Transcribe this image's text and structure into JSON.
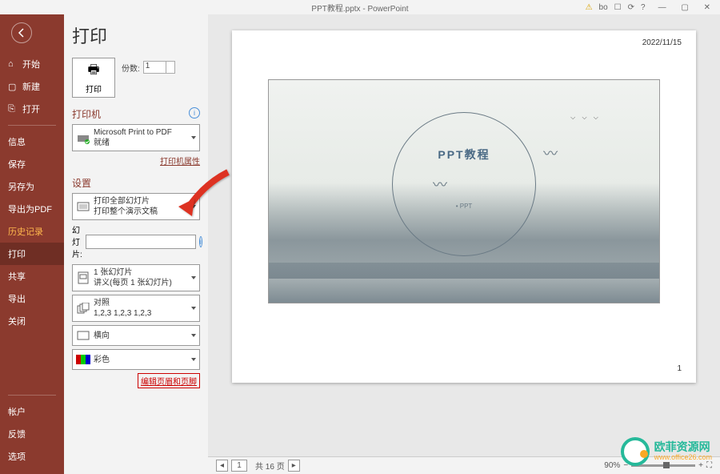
{
  "titlebar": {
    "filename": "PPT教程.pptx",
    "appname": "PowerPoint",
    "user": "bo"
  },
  "sidebar": {
    "start": "开始",
    "new": "新建",
    "open": "打开",
    "info": "信息",
    "save": "保存",
    "saveas": "另存为",
    "exportpdf": "导出为PDF",
    "history": "历史记录",
    "print": "打印",
    "share": "共享",
    "export": "导出",
    "close": "关闭",
    "account": "帐户",
    "feedback": "反馈",
    "options": "选项"
  },
  "page": {
    "title": "打印"
  },
  "print_button": {
    "label": "打印"
  },
  "copies": {
    "label": "份数:",
    "value": "1"
  },
  "printer": {
    "header": "打印机",
    "name": "Microsoft Print to PDF",
    "status": "就绪",
    "props_link": "打印机属性"
  },
  "settings": {
    "header": "设置",
    "scope": {
      "line1": "打印全部幻灯片",
      "line2": "打印整个演示文稿"
    },
    "slides_label": "幻灯片:",
    "layout": {
      "line1": "1 张幻灯片",
      "line2": "讲义(每页 1 张幻灯片)"
    },
    "collate": {
      "line1": "对照",
      "line2": "1,2,3   1,2,3   1,2,3"
    },
    "orientation": "横向",
    "color": "彩色",
    "footer_link": "编辑页眉和页脚"
  },
  "preview": {
    "date": "2022/11/15",
    "page_number": "1",
    "slide_title": "PPT教程",
    "slide_sub": "• PPT"
  },
  "statusbar": {
    "page_text": "共 16 页",
    "current": "1",
    "zoom": "90%"
  },
  "watermark": {
    "name": "欧菲资源网",
    "url": "www.office26.com"
  }
}
